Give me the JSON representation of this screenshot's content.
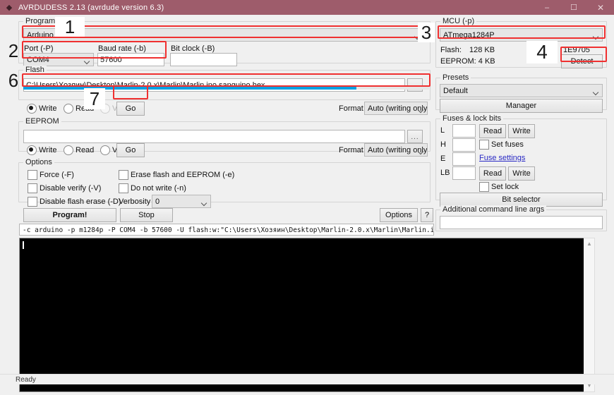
{
  "window": {
    "title": "AVRDUDESS 2.13 (avrdude version 6.3)",
    "app_icon": "diamond-icon",
    "minimize_label": "–",
    "maximize_label": "☐",
    "close_label": "✕",
    "titlebar_color": "#9e5c6b",
    "status_text": "Ready"
  },
  "programmer": {
    "group_label": "Programmer (-c)",
    "value": "Arduino",
    "port_label": "Port (-P)",
    "port_value": "COM4",
    "baud_label": "Baud rate (-b)",
    "baud_value": "57600",
    "bitclock_label": "Bit clock (-B)",
    "bitclock_value": ""
  },
  "flash": {
    "group_label": "Flash",
    "path": "C:\\Users\\Хозяин\\Desktop\\Marlin-2.0.x\\Marlin\\Marlin.ino.sanguino.hex",
    "browse_label": "...",
    "write_label": "Write",
    "read_label": "Read",
    "verify_label": "Verify",
    "go_label": "Go",
    "format_label": "Format",
    "format_value": "Auto (writing only)",
    "progress_percent": 82,
    "progress_color": "#0aa1e2"
  },
  "eeprom": {
    "group_label": "EEPROM",
    "path": "",
    "browse_label": "...",
    "write_label": "Write",
    "read_label": "Read",
    "verify_label": "Verify",
    "go_label": "Go",
    "format_label": "Format",
    "format_value": "Auto (writing only)"
  },
  "options": {
    "group_label": "Options",
    "force_label": "Force (-F)",
    "disable_verify_label": "Disable verify (-V)",
    "disable_flash_erase_label": "Disable flash erase (-D)",
    "erase_flash_eeprom_label": "Erase flash and EEPROM (-e)",
    "do_not_write_label": "Do not write (-n)",
    "verbosity_label": "Verbosity",
    "verbosity_value": "0"
  },
  "actions": {
    "program_label": "Program!",
    "stop_label": "Stop",
    "options_label": "Options",
    "help_label": "?"
  },
  "command_line": {
    "value": "-c arduino -p m1284p -P COM4 -b 57600 -U flash:w:\"C:\\Users\\Хозяин\\Desktop\\Marlin-2.0.x\\Marlin\\Marlin.ino.sanguino.hex\":a"
  },
  "mcu": {
    "group_label": "MCU (-p)",
    "value": "ATmega1284P",
    "flash_label": "Flash:",
    "flash_size": "128 KB",
    "eeprom_label": "EEPROM: 4 KB",
    "signature": "1E9705",
    "detect_label": "Detect"
  },
  "presets": {
    "group_label": "Presets",
    "value": "Default",
    "manager_label": "Manager"
  },
  "fuses": {
    "group_label": "Fuses & lock bits",
    "l_label": "L",
    "l_value": "",
    "h_label": "H",
    "h_value": "",
    "e_label": "E",
    "e_value": "",
    "lb_label": "LB",
    "lb_value": "",
    "read_label": "Read",
    "write_label": "Write",
    "set_fuses_label": "Set fuses",
    "fuse_settings_label": "Fuse settings",
    "set_lock_label": "Set lock",
    "bit_selector_label": "Bit selector"
  },
  "extra_args": {
    "group_label": "Additional command line args",
    "value": ""
  },
  "annotations": {
    "color": "#f03030",
    "steps": [
      {
        "id": "1",
        "label": "1"
      },
      {
        "id": "2",
        "label": "2"
      },
      {
        "id": "3",
        "label": "3"
      },
      {
        "id": "4",
        "label": "4"
      },
      {
        "id": "6",
        "label": "6"
      },
      {
        "id": "7",
        "label": "7"
      }
    ]
  }
}
